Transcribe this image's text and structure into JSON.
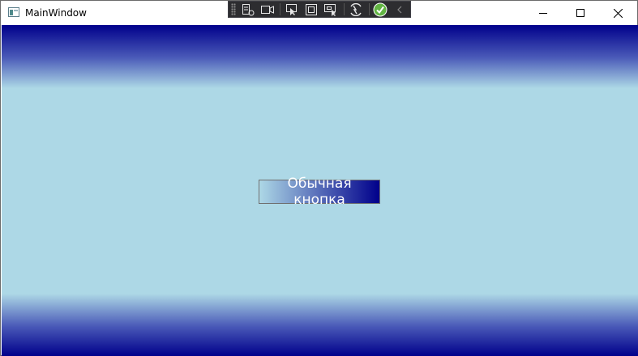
{
  "window": {
    "title": "MainWindow"
  },
  "debug_toolbar": {
    "icons": [
      "live-visual-tree-icon",
      "record-icon",
      "select-element-icon",
      "adorner-icon",
      "track-focus-icon",
      "hot-reload-icon",
      "check-icon",
      "collapse-chevron-icon"
    ]
  },
  "window_controls": {
    "minimize": "minimize-icon",
    "maximize": "maximize-icon",
    "close": "close-icon"
  },
  "content": {
    "button_label": "Обычная кнопка",
    "colors": {
      "gradient_outer": "#00008b",
      "gradient_inner": "#add8e6",
      "button_gradient_start": "#add8e6",
      "button_gradient_end": "#00008b",
      "button_text": "#ffffff"
    }
  }
}
